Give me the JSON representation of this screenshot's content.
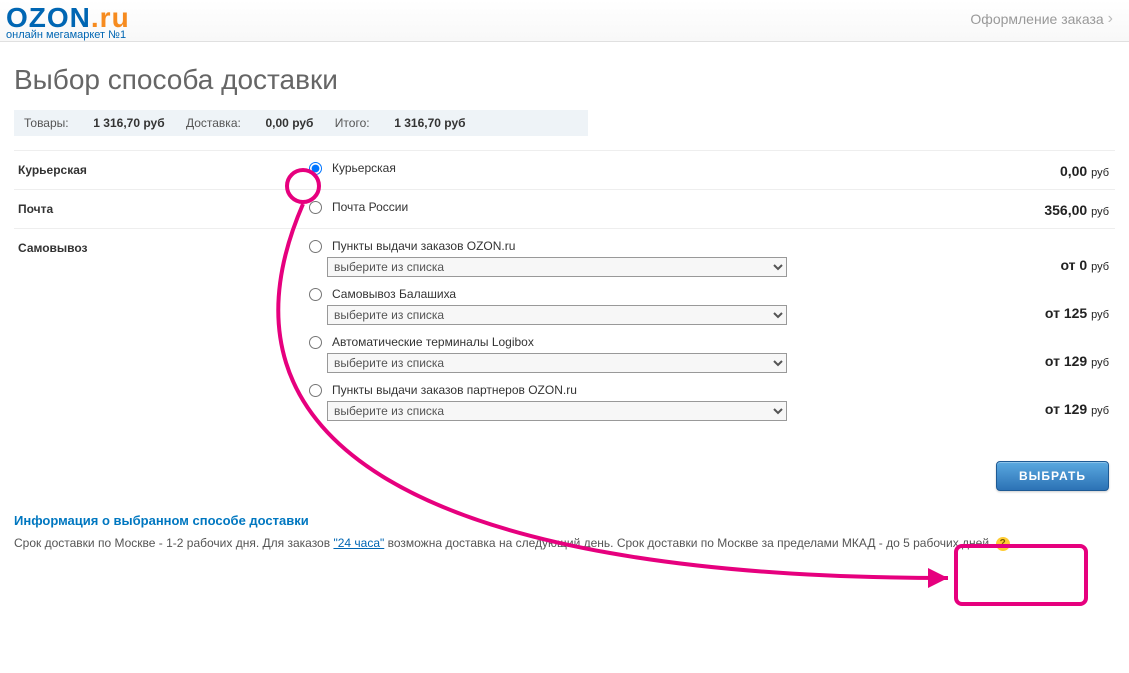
{
  "logo": {
    "ozon": "OZON",
    "dot": ".",
    "ru": "ru",
    "sub": "онлайн мегамаркет №1"
  },
  "breadcrumb": "Оформление заказа",
  "page_title": "Выбор способа доставки",
  "summary": {
    "goods_label": "Товары:",
    "goods_value": "1 316,70 руб",
    "delivery_label": "Доставка:",
    "delivery_value": "0,00 руб",
    "total_label": "Итого:",
    "total_value": "1 316,70 руб"
  },
  "rub": "руб",
  "rows": {
    "courier": {
      "cat": "Курьерская",
      "opt": "Курьерская",
      "price": "0,00"
    },
    "post": {
      "cat": "Почта",
      "opt": "Почта России",
      "price": "356,00"
    },
    "pickup": {
      "cat": "Самовывоз"
    }
  },
  "pickup_opts": [
    {
      "label": "Пункты выдачи заказов OZON.ru",
      "price": "от 0"
    },
    {
      "label": "Самовывоз Балашиха",
      "price": "от 125"
    },
    {
      "label": "Автоматические терминалы Logibox",
      "price": "от 129"
    },
    {
      "label": "Пункты выдачи заказов партнеров OZON.ru",
      "price": "от 129"
    }
  ],
  "select_placeholder": "выберите из списка",
  "btn_select": "ВЫБРАТЬ",
  "info": {
    "title": "Информация о выбранном способе доставки",
    "t1": "Срок доставки по Москве - 1-2 рабочих дня. Для заказов ",
    "link": "\"24 часа\"",
    "t2": " возможна доставка на следующий день. Срок доставки по Москве за пределами МКАД - до 5 рабочих дней. "
  }
}
